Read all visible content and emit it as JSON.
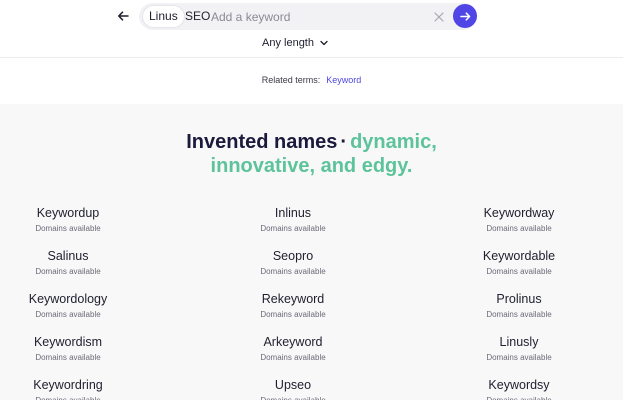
{
  "search": {
    "chips": [
      "Linus",
      "SEO"
    ],
    "placeholder": "Add a keyword"
  },
  "filter": {
    "length_label": "Any length"
  },
  "related": {
    "label": "Related terms:",
    "terms": [
      "Keyword"
    ]
  },
  "headline": {
    "part1": "Invented names",
    "part2": "dynamic,",
    "part3": "innovative, and edgy."
  },
  "results": {
    "availability_label": "Domains available",
    "names": [
      [
        "Keywordup",
        "Inlinus",
        "Keywordway"
      ],
      [
        "Salinus",
        "Seopro",
        "Keywordable"
      ],
      [
        "Keywordology",
        "Rekeyword",
        "Prolinus"
      ],
      [
        "Keywordism",
        "Arkeyword",
        "Linusly"
      ],
      [
        "Keywordring",
        "Upseo",
        "Keywordsy"
      ]
    ]
  },
  "icons": {
    "back": "arrow-left-icon",
    "clear": "close-icon",
    "go": "arrow-right-icon",
    "dropdown": "chevron-down-icon"
  },
  "colors": {
    "accent": "#4f46e5",
    "green": "#5cc39a",
    "navy": "#1a1a3c"
  }
}
